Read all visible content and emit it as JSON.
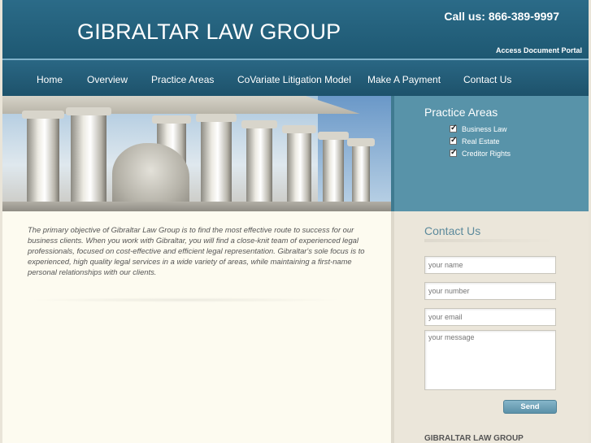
{
  "header": {
    "logo_text": "GIBRALTAR LAW GROUP",
    "phone": "Call us: 866-389-9997",
    "portal_link": "Access Document Portal"
  },
  "nav": {
    "items": [
      {
        "label": "Home"
      },
      {
        "label": "Overview"
      },
      {
        "label": "Practice Areas"
      },
      {
        "label": "CoVariate Litigation Model"
      },
      {
        "label": "Make A Payment"
      },
      {
        "label": "Contact Us"
      }
    ]
  },
  "hero": {
    "image": "supreme-court-columns-photo"
  },
  "practice_areas": {
    "title": "Practice Areas",
    "items": [
      {
        "label": "Business Law",
        "checked": true
      },
      {
        "label": "Real Estate",
        "checked": true
      },
      {
        "label": "Creditor Rights",
        "checked": true
      }
    ]
  },
  "main": {
    "intro": "The primary objective of Gibraltar Law Group is to find the most effective route to success for our business clients. When you work with Gibraltar, you will find a close-knit team of experienced legal professionals, focused on cost-effective and efficient legal representation. Gibraltar's sole focus is to experienced, high quality legal services in a wide variety of areas, while maintaining a first-name personal relationships with our clients."
  },
  "contact": {
    "title": "Contact Us",
    "name_placeholder": "your name",
    "number_placeholder": "your number",
    "email_placeholder": "your email",
    "message_placeholder": "your message",
    "send_label": "Send"
  },
  "footer_sidebar": {
    "company": "GIBRALTAR LAW GROUP"
  },
  "colors": {
    "header_bg": "#236282",
    "practice_box_bg": "#5893a9",
    "content_bg": "#fdfbf0",
    "sidebar_bg": "#ebe6da",
    "accent_text": "#5c8a9c"
  }
}
